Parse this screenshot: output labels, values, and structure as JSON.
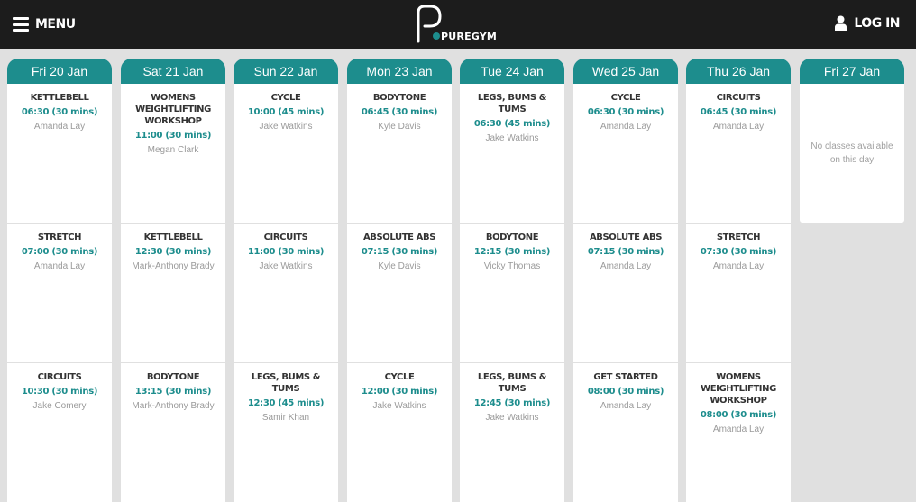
{
  "header": {
    "menu_label": "MENU",
    "brand": "PUREGYM",
    "login_label": "LOG IN",
    "colors": {
      "bar": "#1c1c1c",
      "accent": "#1d8d8d"
    }
  },
  "days": [
    {
      "label": "Fri 20 Jan",
      "classes": [
        {
          "name": "KETTLEBELL",
          "time": "06:30 (30 mins)",
          "instructor": "Amanda Lay"
        },
        {
          "name": "STRETCH",
          "time": "07:00 (30 mins)",
          "instructor": "Amanda Lay"
        },
        {
          "name": "CIRCUITS",
          "time": "10:30 (30 mins)",
          "instructor": "Jake Comery"
        }
      ]
    },
    {
      "label": "Sat 21 Jan",
      "classes": [
        {
          "name": "WOMENS WEIGHTLIFTING WORKSHOP",
          "time": "11:00 (30 mins)",
          "instructor": "Megan Clark"
        },
        {
          "name": "KETTLEBELL",
          "time": "12:30 (30 mins)",
          "instructor": "Mark-Anthony Brady"
        },
        {
          "name": "BODYTONE",
          "time": "13:15 (30 mins)",
          "instructor": "Mark-Anthony Brady"
        }
      ]
    },
    {
      "label": "Sun 22 Jan",
      "classes": [
        {
          "name": "CYCLE",
          "time": "10:00 (45 mins)",
          "instructor": "Jake Watkins"
        },
        {
          "name": "CIRCUITS",
          "time": "11:00 (30 mins)",
          "instructor": "Jake Watkins"
        },
        {
          "name": "LEGS, BUMS & TUMS",
          "time": "12:30 (45 mins)",
          "instructor": "Samir Khan"
        }
      ]
    },
    {
      "label": "Mon 23 Jan",
      "classes": [
        {
          "name": "BODYTONE",
          "time": "06:45 (30 mins)",
          "instructor": "Kyle Davis"
        },
        {
          "name": "ABSOLUTE ABS",
          "time": "07:15 (30 mins)",
          "instructor": "Kyle Davis"
        },
        {
          "name": "CYCLE",
          "time": "12:00 (30 mins)",
          "instructor": "Jake Watkins"
        }
      ]
    },
    {
      "label": "Tue 24 Jan",
      "classes": [
        {
          "name": "LEGS, BUMS & TUMS",
          "time": "06:30 (45 mins)",
          "instructor": "Jake Watkins"
        },
        {
          "name": "BODYTONE",
          "time": "12:15 (30 mins)",
          "instructor": "Vicky Thomas"
        },
        {
          "name": "LEGS, BUMS & TUMS",
          "time": "12:45 (30 mins)",
          "instructor": "Jake Watkins"
        }
      ]
    },
    {
      "label": "Wed 25 Jan",
      "classes": [
        {
          "name": "CYCLE",
          "time": "06:30 (30 mins)",
          "instructor": "Amanda Lay"
        },
        {
          "name": "ABSOLUTE ABS",
          "time": "07:15 (30 mins)",
          "instructor": "Amanda Lay"
        },
        {
          "name": "GET STARTED",
          "time": "08:00 (30 mins)",
          "instructor": "Amanda Lay"
        }
      ]
    },
    {
      "label": "Thu 26 Jan",
      "classes": [
        {
          "name": "CIRCUITS",
          "time": "06:45 (30 mins)",
          "instructor": "Amanda Lay"
        },
        {
          "name": "STRETCH",
          "time": "07:30 (30 mins)",
          "instructor": "Amanda Lay"
        },
        {
          "name": "WOMENS WEIGHTLIFTING WORKSHOP",
          "time": "08:00 (30 mins)",
          "instructor": "Amanda Lay"
        }
      ]
    },
    {
      "label": "Fri 27 Jan",
      "empty_message": "No classes available on this day",
      "classes": []
    }
  ]
}
